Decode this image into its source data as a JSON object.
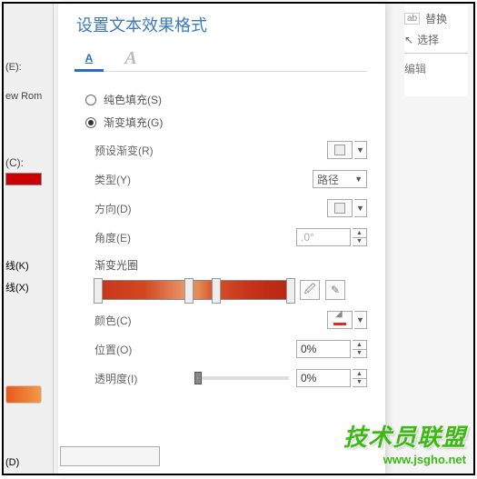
{
  "leftPane": {
    "f": "(E):",
    "romi": "ew Rom",
    "c": "(C):",
    "k": "线(K)",
    "x": "线(X)",
    "d": "(D)"
  },
  "ribbon": {
    "replace": "替换",
    "select": "选择",
    "edit": "编辑"
  },
  "panel": {
    "title": "设置文本效果格式",
    "radios": {
      "solid": "纯色填充(S)",
      "gradient": "渐变填充(G)"
    },
    "rows": {
      "preset": "预设渐变(R)",
      "type": "类型(Y)",
      "typeValue": "路径",
      "direction": "方向(D)",
      "angle": "角度(E)",
      "angleValue": ".0°",
      "stops": "渐变光圈",
      "color": "颜色(C)",
      "position": "位置(O)",
      "positionValue": "0%",
      "transparency": "透明度(I)",
      "transparencyValue": "0%"
    }
  },
  "watermark": {
    "logo": "技术员联盟",
    "url": "www.jsgho.net"
  }
}
